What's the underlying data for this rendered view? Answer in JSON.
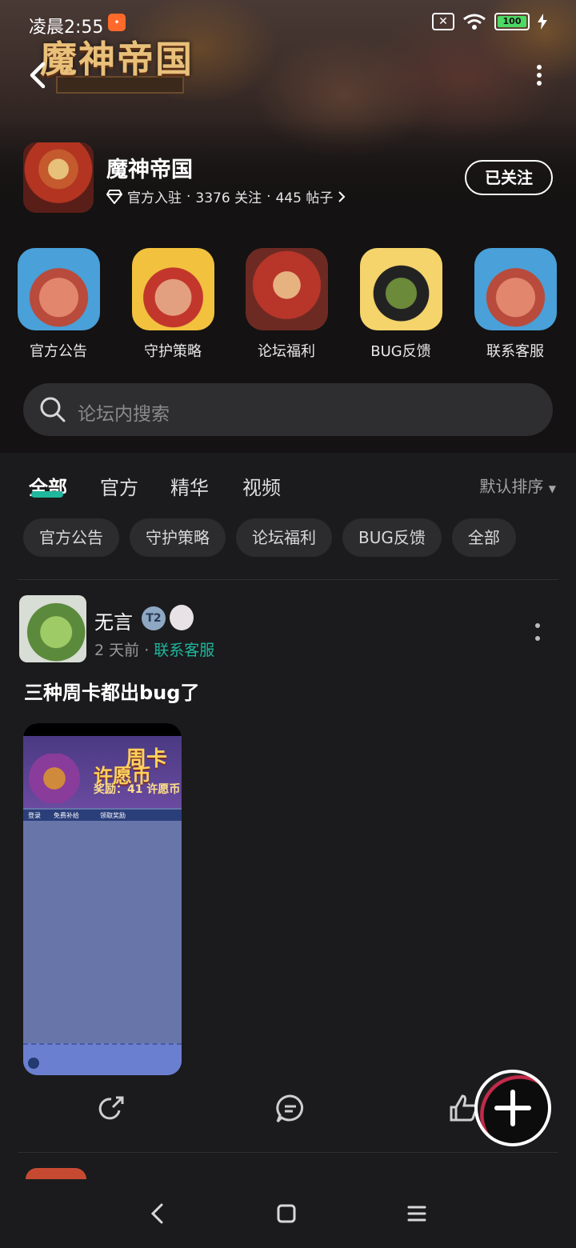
{
  "status": {
    "time": "凌晨2:55",
    "notif": "•",
    "battery": "100"
  },
  "header": {
    "game_logo": "魔神帝国",
    "forum_name": "魔神帝国",
    "official_label": "官方入驻",
    "followers": "3376 关注",
    "posts": "445 帖子",
    "follow_button": "已关注"
  },
  "shortcuts": [
    {
      "label": "官方公告"
    },
    {
      "label": "守护策略"
    },
    {
      "label": "论坛福利"
    },
    {
      "label": "BUG反馈"
    },
    {
      "label": "联系客服"
    }
  ],
  "search": {
    "placeholder": "论坛内搜索"
  },
  "tabs": [
    {
      "label": "全部"
    },
    {
      "label": "官方"
    },
    {
      "label": "精华"
    },
    {
      "label": "视频"
    }
  ],
  "sort_label": "默认排序",
  "chips": [
    {
      "label": "官方公告"
    },
    {
      "label": "守护策略"
    },
    {
      "label": "论坛福利"
    },
    {
      "label": "BUG反馈"
    },
    {
      "label": "全部"
    }
  ],
  "post": {
    "author": "无言",
    "badge": "T2",
    "time": "2 天前",
    "category": "联系客服",
    "title": "三种周卡都出bug了",
    "image": {
      "h1": "周卡",
      "h2": "许愿币",
      "h3": "奖励：41 许愿币",
      "bar_1": "登录",
      "bar_2": "免费补给",
      "bar_3": "领取奖励"
    }
  },
  "colors": {
    "accent": "#1fb79d",
    "background": "#1b1b1d"
  }
}
